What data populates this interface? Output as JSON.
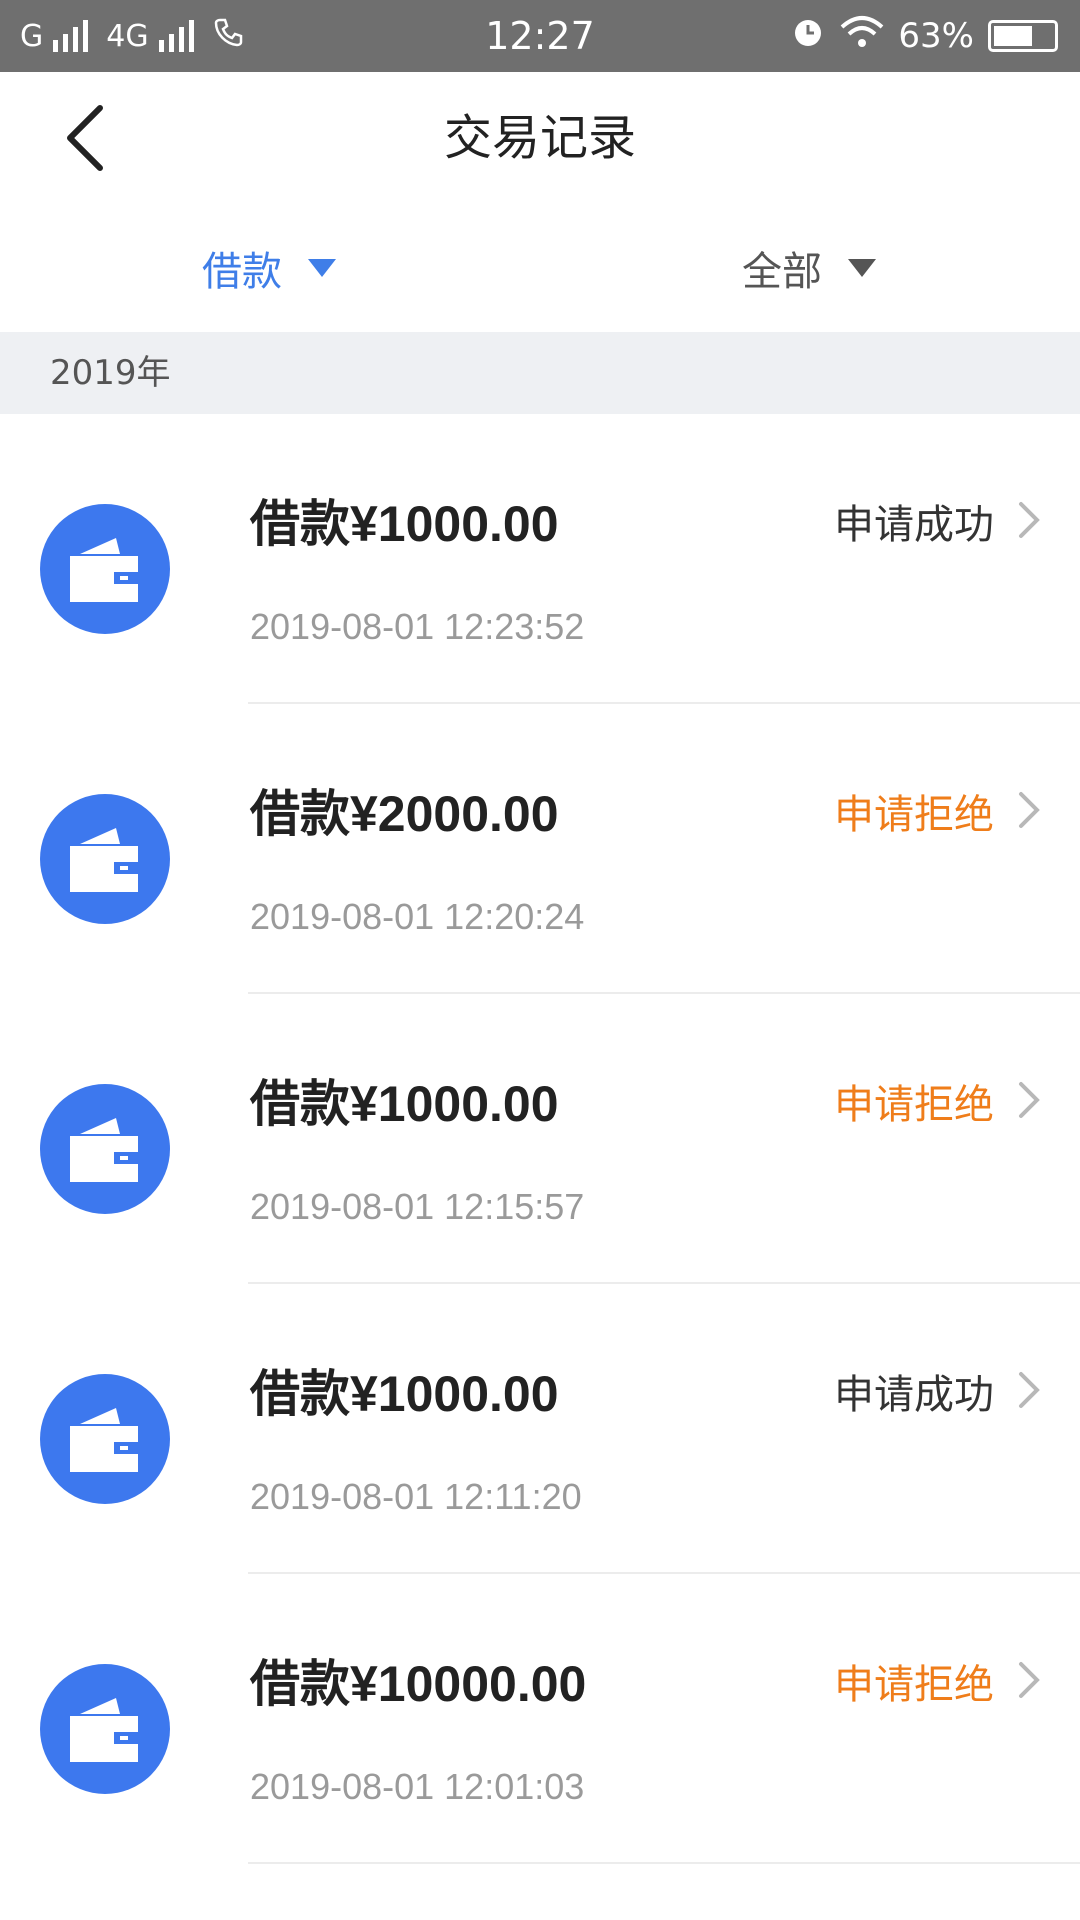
{
  "status_bar": {
    "carrier1": "G",
    "carrier2": "4G",
    "time": "12:27",
    "battery": "63%"
  },
  "header": {
    "title": "交易记录"
  },
  "filters": {
    "type_label": "借款",
    "status_label": "全部"
  },
  "year_section": "2019年",
  "colors": {
    "accent": "#3f7ee8",
    "reject": "#ef7d1a",
    "icon_bg": "#3d78ee"
  },
  "records": [
    {
      "amount": "借款¥1000.00",
      "datetime": "2019-08-01 12:23:52",
      "status": "申请成功"
    },
    {
      "amount": "借款¥2000.00",
      "datetime": "2019-08-01 12:20:24",
      "status": "申请拒绝"
    },
    {
      "amount": "借款¥1000.00",
      "datetime": "2019-08-01 12:15:57",
      "status": "申请拒绝"
    },
    {
      "amount": "借款¥1000.00",
      "datetime": "2019-08-01 12:11:20",
      "status": "申请成功"
    },
    {
      "amount": "借款¥10000.00",
      "datetime": "2019-08-01 12:01:03",
      "status": "申请拒绝"
    }
  ]
}
